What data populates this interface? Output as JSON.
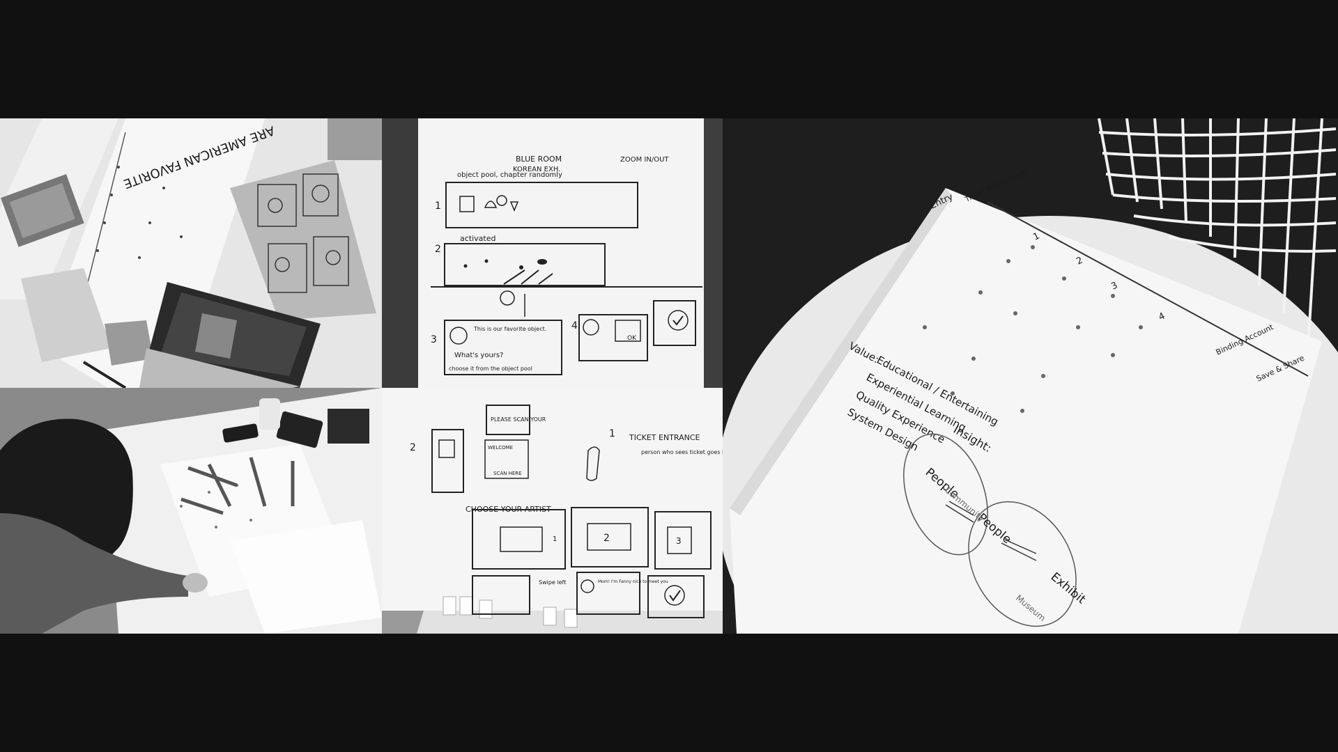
{
  "collage": {
    "background": "#111111",
    "panels": [
      {
        "id": "sketch-table",
        "subject": "table with paper sketches and laptop"
      },
      {
        "id": "storyboard-blue-room",
        "subject": "storyboard sheet on whiteboard"
      },
      {
        "id": "journey-map",
        "subject": "journey map sheet on round table"
      },
      {
        "id": "woman-sketching",
        "subject": "person sketching at table"
      },
      {
        "id": "storyboard-ticket",
        "subject": "second storyboard sheet"
      }
    ]
  },
  "storyboard_top": {
    "title": "BLUE ROOM",
    "subtitle": "KOREAN EXH.",
    "caption": "object pool, chapter randomly",
    "zoom": "ZOOM IN/OUT",
    "step1": "1",
    "step2": "2",
    "step2_label": "activated",
    "step3": "3",
    "step4": "4",
    "bubble1": "This is our favorite object.",
    "bubble2": "What's yours?",
    "bubble3": "choose it from the object pool",
    "ok": "OK"
  },
  "storyboard_bottom": {
    "step1": "1",
    "ticket": "TICKET ENTRANCE",
    "ticket_note": "person who sees ticket goes instruction of how wristband works",
    "step2": "2",
    "scan": "PLEASE SCAN YOUR",
    "welcome": "WELCOME",
    "scan_btn": "SCAN HERE",
    "choose": "CHOOSE YOUR ARTIST",
    "n1": "1",
    "n2": "2",
    "n3": "3",
    "photo": "Swipe left",
    "friend": "Mom! I'm Fanny nice to meet you"
  },
  "journey_map": {
    "labels": [
      "Entry",
      "Ticket ID Enclosure",
      "1",
      "2",
      "3",
      "4",
      "Binding Account",
      "Save & Share"
    ],
    "value_title": "Value:",
    "values": [
      "Educational / Entertaining",
      "Experiential Learning",
      "Quality Experience",
      "System Design"
    ],
    "insight_title": "Insight:",
    "insight_people": "People",
    "insight_people2": "People",
    "insight_community": "Community",
    "insight_exhibit": "Exhibit",
    "insight_museum": "Museum"
  },
  "sketch_table": {
    "poster_text": "ARE AMERICAN FAVORITE",
    "timeline_labels": [
      "Entry",
      "Ticket ID Enclosure"
    ]
  }
}
